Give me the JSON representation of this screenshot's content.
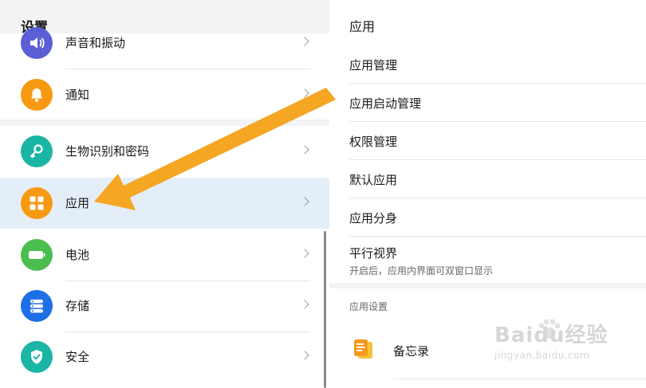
{
  "settings": {
    "title": "设置",
    "top_partial_label": "声音和振动",
    "items": [
      {
        "label": "通知",
        "icon": "bell-icon",
        "color": "#f79a11"
      },
      {
        "label": "生物识别和密码",
        "icon": "key-icon",
        "color": "#1bb5a6"
      },
      {
        "label": "应用",
        "icon": "apps-grid-icon",
        "color": "#f79a11"
      },
      {
        "label": "电池",
        "icon": "battery-icon",
        "color": "#4cbe50"
      },
      {
        "label": "存储",
        "icon": "storage-icon",
        "color": "#1e6fe5"
      },
      {
        "label": "安全",
        "icon": "shield-icon",
        "color": "#1bb5a6"
      }
    ],
    "top_icon_color": "#5a5fd6"
  },
  "apps_panel": {
    "title": "应用",
    "items": [
      {
        "label": "应用管理"
      },
      {
        "label": "应用启动管理"
      },
      {
        "label": "权限管理"
      },
      {
        "label": "默认应用"
      },
      {
        "label": "应用分身"
      },
      {
        "label": "平行视界",
        "subtitle": "开启后，应用内界面可双窗口显示"
      }
    ],
    "section_label": "应用设置",
    "memo": {
      "label": "备忘录",
      "icon": "memo-app-icon",
      "color": "#f39a1f"
    }
  },
  "annotation": {
    "color": "#f5a623"
  },
  "watermark": {
    "logo": "Baidu经验",
    "url": "jingyan.baidu.com"
  },
  "colors": {
    "active_row": "#e4eef9",
    "background": "#f1f3f5"
  }
}
